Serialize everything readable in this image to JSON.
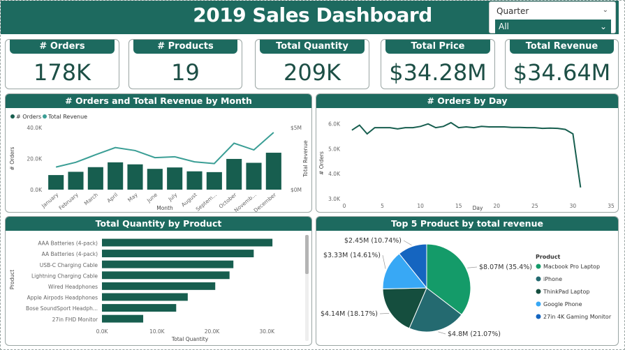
{
  "dashboard": {
    "title": "2019 Sales Dashboard",
    "slicer": {
      "label": "Quarter",
      "selected": "All"
    }
  },
  "kpis": [
    {
      "label": "# Orders",
      "value": "178K"
    },
    {
      "label": "# Products",
      "value": "19"
    },
    {
      "label": "Total Quantity",
      "value": "209K"
    },
    {
      "label": "Total Price",
      "value": "$34.28M"
    },
    {
      "label": "Total Revenue",
      "value": "$34.64M"
    }
  ],
  "colors": {
    "header": "#1d6a5f",
    "bar": "#175e4f",
    "line": "#3a9e95",
    "pie": [
      "#149b69",
      "#246a70",
      "#154e3e",
      "#38a8f5",
      "#1565c0"
    ]
  },
  "chart_data": [
    {
      "type": "bar",
      "title": "# Orders and Total Revenue by Month",
      "legend": [
        "# Orders",
        "Total Revenue"
      ],
      "legend_placement": "top-left",
      "xlabel": "Month",
      "ylabel": "# Orders",
      "y2label": "Total Revenue",
      "categories": [
        "January",
        "February",
        "March",
        "April",
        "May",
        "June",
        "July",
        "August",
        "Septem...",
        "October",
        "Novemb...",
        "December"
      ],
      "series": [
        {
          "name": "# Orders",
          "type": "bar",
          "axis": "left",
          "values": [
            9400,
            11500,
            14500,
            17600,
            16300,
            13400,
            14300,
            11800,
            11300,
            19800,
            17300,
            23800
          ]
        },
        {
          "name": "Total Revenue",
          "type": "line",
          "axis": "right",
          "values": [
            1.82,
            2.2,
            2.81,
            3.39,
            3.15,
            2.58,
            2.65,
            2.24,
            2.1,
            3.74,
            3.2,
            4.61
          ]
        }
      ],
      "yticks": [
        "0.0K",
        "20.0K",
        "40.0K"
      ],
      "ylim": [
        0,
        40000
      ],
      "y2ticks": [
        "$0M",
        "$5M"
      ],
      "y2lim": [
        0,
        5
      ]
    },
    {
      "type": "line",
      "title": "# Orders by Day",
      "xlabel": "Day",
      "ylabel": "# Orders",
      "x": [
        1,
        2,
        3,
        4,
        5,
        6,
        7,
        8,
        9,
        10,
        11,
        12,
        13,
        14,
        15,
        16,
        17,
        18,
        19,
        20,
        21,
        22,
        23,
        24,
        25,
        26,
        27,
        28,
        29,
        30,
        31
      ],
      "values": [
        5750,
        5950,
        5600,
        5850,
        5850,
        5850,
        5800,
        5850,
        5850,
        5900,
        6000,
        5850,
        5900,
        6050,
        5850,
        5880,
        5850,
        5900,
        5880,
        5880,
        5880,
        5860,
        5860,
        5850,
        5850,
        5820,
        5830,
        5820,
        5780,
        5600,
        3450
      ],
      "xticks": [
        "0",
        "5",
        "10",
        "15",
        "20",
        "25",
        "30",
        "35"
      ],
      "xlim": [
        0,
        35
      ],
      "yticks": [
        "3.0K",
        "4.0K",
        "5.0K",
        "6.0K"
      ],
      "ylim": [
        3000,
        6300
      ]
    },
    {
      "type": "bar",
      "orientation": "horizontal",
      "title": "Total Quantity by Product",
      "xlabel": "Total Quantity",
      "ylabel": "Product",
      "categories": [
        "AAA Batteries (4-pack)",
        "AA Batteries (4-pack)",
        "USB-C Charging Cable",
        "Lightning Charging Cable",
        "Wired Headphones",
        "Apple Airpods Headphones",
        "Bose SoundSport Headph...",
        "27in FHD Monitor"
      ],
      "values": [
        31000,
        27600,
        23900,
        23200,
        20600,
        15600,
        13500,
        7500
      ],
      "xticks": [
        "0.0K",
        "10.0K",
        "20.0K",
        "30.0K"
      ],
      "xlim": [
        0,
        32000
      ]
    },
    {
      "type": "pie",
      "title": "Top 5 Product by total revenue",
      "legend_title": "Product",
      "legend_placement": "right",
      "labels": [
        "Macbook Pro Laptop",
        "iPhone",
        "ThinkPad Laptop",
        "Google Phone",
        "27in 4K Gaming Monitor"
      ],
      "values": [
        8.07,
        4.8,
        4.14,
        3.33,
        2.45
      ],
      "data_labels": [
        "$8.07M (35.4%)",
        "$4.8M (21.07%)",
        "$4.14M (18.17%)",
        "$3.33M (14.61%)",
        "$2.45M (10.74%)"
      ]
    }
  ]
}
